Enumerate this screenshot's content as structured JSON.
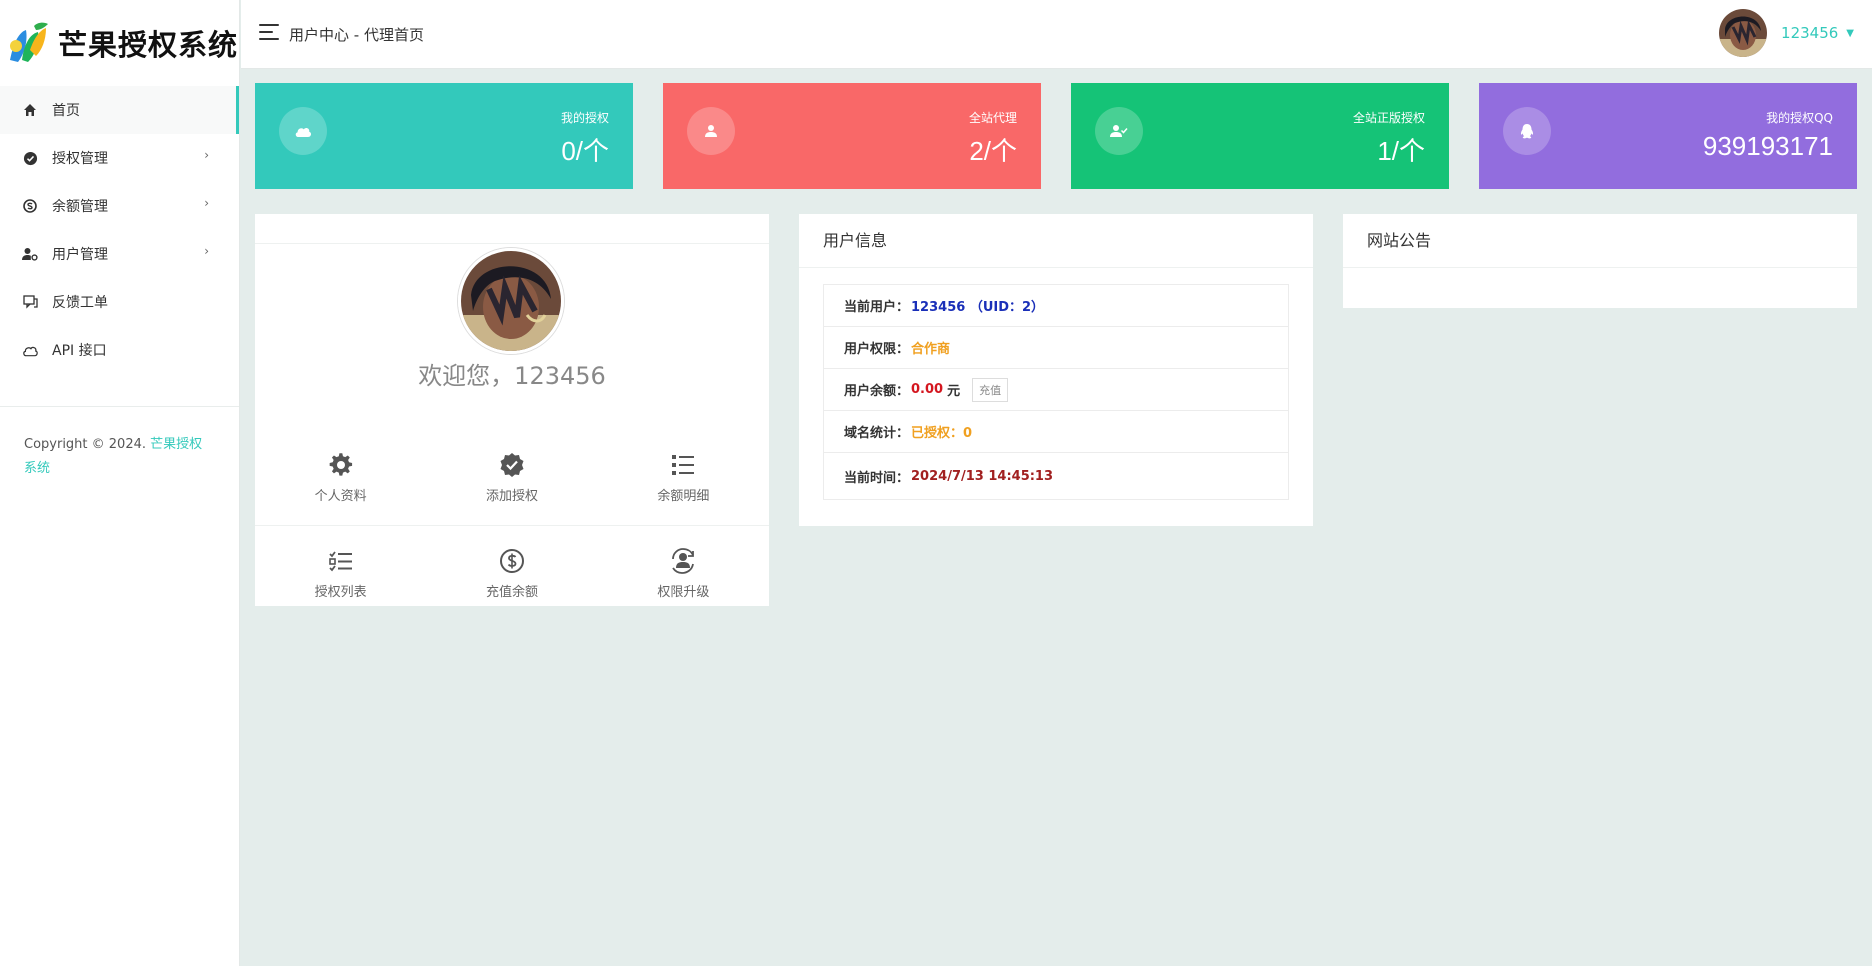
{
  "brand": {
    "name": "芒果授权系统"
  },
  "sidebar": {
    "items": [
      {
        "label": "首页",
        "icon": "home-icon",
        "active": true
      },
      {
        "label": "授权管理",
        "icon": "verified-icon",
        "submenu": true
      },
      {
        "label": "余额管理",
        "icon": "skype-icon",
        "submenu": true
      },
      {
        "label": "用户管理",
        "icon": "user-cog-icon",
        "submenu": true
      },
      {
        "label": "反馈工单",
        "icon": "chat-icon"
      },
      {
        "label": "API 接口",
        "icon": "cloud-icon"
      }
    ],
    "caret": "›",
    "copyright_prefix": "Copyright © 2024. ",
    "copyright_brand": "芒果授权系统"
  },
  "header": {
    "breadcrumb": "用户中心 - 代理首页",
    "username": "123456",
    "caret": "▼"
  },
  "stats": [
    {
      "label": "我的授权",
      "value": "0/个",
      "color": "#33c9bb",
      "icon": "cloud-icon"
    },
    {
      "label": "全站代理",
      "value": "2/个",
      "color": "#f96868",
      "icon": "user-icon"
    },
    {
      "label": "全站正版授权",
      "value": "1/个",
      "color": "#15c377",
      "icon": "user-check-icon"
    },
    {
      "label": "我的授权QQ",
      "value": "939193171",
      "color": "#926dde",
      "icon": "qq-icon"
    }
  ],
  "profile": {
    "welcome": "欢迎您，123456",
    "actions": [
      {
        "label": "个人资料",
        "icon": "gear-icon"
      },
      {
        "label": "添加授权",
        "icon": "verified-icon"
      },
      {
        "label": "余额明细",
        "icon": "list-icon"
      },
      {
        "label": "授权列表",
        "icon": "checklist-icon"
      },
      {
        "label": "充值余额",
        "icon": "dollar-icon"
      },
      {
        "label": "权限升级",
        "icon": "user-upgrade-icon"
      }
    ]
  },
  "user_info": {
    "title": "用户信息",
    "current_user_label": "当前用户：",
    "current_user_value": "123456 （UID：2）",
    "role_label": "用户权限：",
    "role_value": "合作商",
    "balance_label": "用户余额：",
    "balance_value": "0.00",
    "balance_unit": "元",
    "recharge_label": "充值",
    "domain_label": "域名统计：",
    "domain_value": "已授权：0",
    "time_label": "当前时间：",
    "time_value": "2024/7/13 14:45:13"
  },
  "notice": {
    "title": "网站公告"
  }
}
